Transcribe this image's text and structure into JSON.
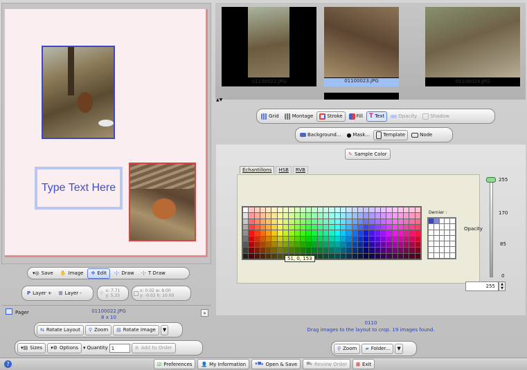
{
  "canvas": {
    "text_box": "Type Text Here"
  },
  "toolbar": {
    "save": "Save",
    "image": "Image",
    "edit": "Edit",
    "draw": "Draw",
    "tdraw": "T Draw",
    "layer_plus": "Layer +",
    "layer_minus": "Layer -",
    "pos_x": "x: 7.71",
    "pos_y": "y: 5.33",
    "size_xw": "x: 0.02 w: 8.00",
    "size_yh": "y: -0.02 h: 10.00"
  },
  "pager": {
    "label": "Pager",
    "filename": "01100022.JPG",
    "size": "8 x 10",
    "rotate_layout": "Rotate Layout",
    "zoom": "Zoom",
    "rotate_image": "Rotate Image",
    "sizes": "Sizes",
    "options": "Options",
    "quantity_label": "Quantity",
    "quantity": "1",
    "add_to_order": "Add to Order"
  },
  "thumbs": [
    {
      "name": "01100022.JPG"
    },
    {
      "name": "01100023.JPG"
    },
    {
      "name": "01100024.JPG"
    }
  ],
  "tools": {
    "grid": "Grid",
    "montage": "Montage",
    "stroke": "Stroke",
    "fill": "Fill",
    "text": "Text",
    "opacity": "Opacity",
    "shadow": "Shadow",
    "background": "Background...",
    "mask": "Mask...",
    "template": "Template",
    "node": "Node"
  },
  "color": {
    "sample": "Sample Color",
    "tabs": [
      "Échantillons",
      "HSB",
      "RVB"
    ],
    "recent_label": "Dernier :",
    "tooltip": "51, 0, 153",
    "opacity_label": "Opacity",
    "opacity_value": "255",
    "scale": [
      "255",
      "170",
      "85",
      "0"
    ]
  },
  "status": {
    "code": "0110",
    "message": "Drag images to the layout to crop. 19 images found.",
    "zoom": "Zoom",
    "folder": "Folder..."
  },
  "bottom": {
    "preferences": "Preferences",
    "my_information": "My Information",
    "open_save": "Open & Save",
    "review_order": "Review Order",
    "exit": "Exit"
  },
  "colors": {
    "selected_blue": "#5c7ed4",
    "canvas_bg": "#fbeef0",
    "status_text": "#2a3fb0"
  }
}
